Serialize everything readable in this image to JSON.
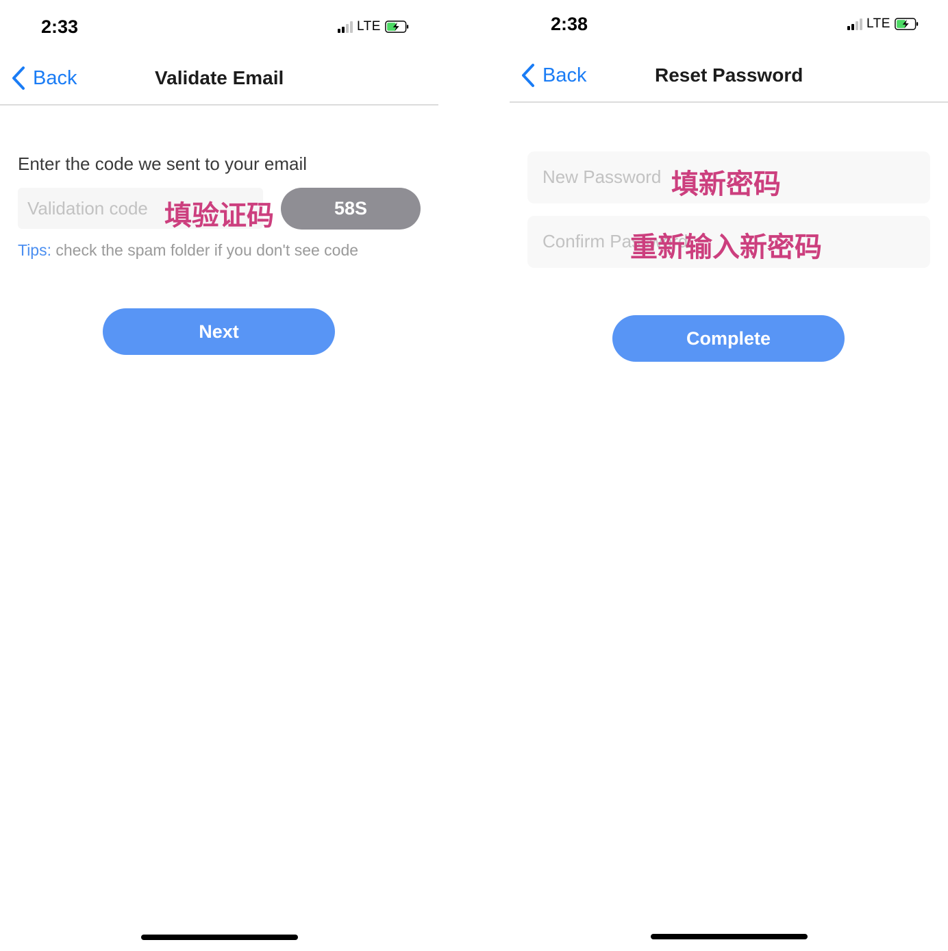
{
  "left": {
    "status": {
      "time": "2:33",
      "network": "LTE"
    },
    "nav": {
      "back_label": "Back",
      "title": "Validate Email"
    },
    "prompt": "Enter the code we sent to your email",
    "code_input": {
      "placeholder": "Validation code",
      "annotation": "填验证码"
    },
    "countdown": "58S",
    "tips": {
      "label": "Tips:",
      "text": " check the spam folder if you don't see code"
    },
    "next_label": "Next"
  },
  "right": {
    "status": {
      "time": "2:38",
      "network": "LTE"
    },
    "nav": {
      "back_label": "Back",
      "title": "Reset Password"
    },
    "new_password": {
      "placeholder": "New Password",
      "annotation": "填新密码"
    },
    "confirm_password": {
      "placeholder": "Confirm Password",
      "annotation": "重新输入新密码"
    },
    "complete_label": "Complete"
  },
  "colors": {
    "accent": "#5895f5",
    "link": "#1a7cf5",
    "countdown_bg": "#8f8e94",
    "annotation": "#cc3f7e",
    "battery_fill": "#4cd964"
  },
  "icons": {
    "back": "chevron-left-icon",
    "signal": "cellular-signal-icon",
    "battery": "battery-charging-icon"
  }
}
